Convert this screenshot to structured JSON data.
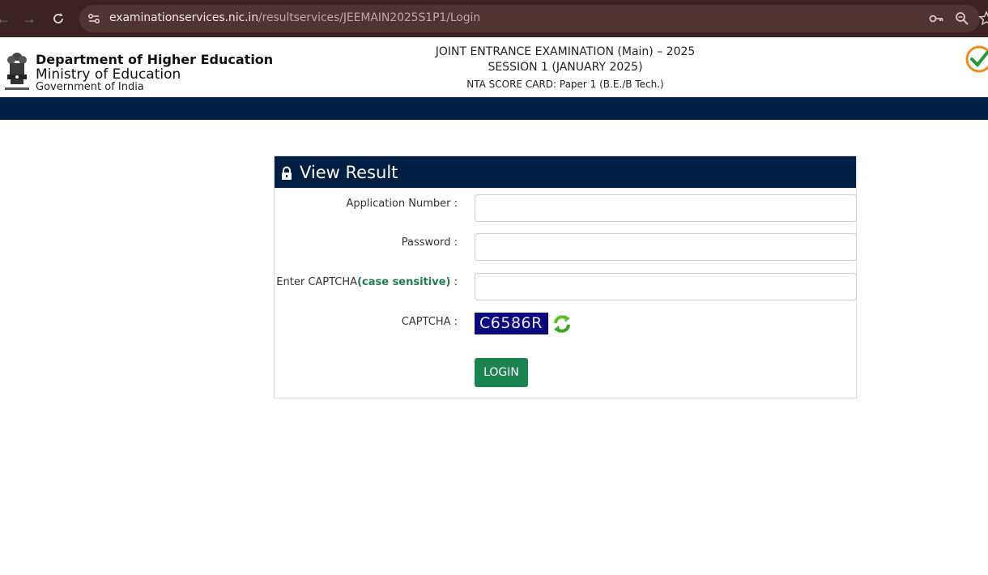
{
  "browser": {
    "url_host": "examinationservices.nic.in",
    "url_path": "/resultservices/JEEMAIN2025S1P1/Login",
    "icons": [
      "back-icon",
      "forward-icon",
      "reload-icon",
      "site-info-icon",
      "key-icon",
      "zoom-icon",
      "star-icon"
    ]
  },
  "header": {
    "dept": "Department of Higher Education",
    "ministry": "Ministry of Education",
    "govt": "Government of India",
    "exam_line1": "JOINT ENTRANCE EXAMINATION (Main) – 2025",
    "exam_line2": "SESSION 1 (JANUARY 2025)",
    "exam_line3": "NTA SCORE CARD: Paper 1 (B.E./B Tech.)"
  },
  "card": {
    "title": "View Result",
    "app_label": "Application Number :",
    "app_value": "",
    "pass_label": "Password :",
    "pass_value": "",
    "captcha_input_label": "Enter CAPTCHA",
    "captcha_note": "(case sensitive)",
    "captcha_input_suffix": " :",
    "captcha_value": "",
    "captcha_label": "CAPTCHA :",
    "captcha_text": "C6586R",
    "login_label": "LOGIN"
  },
  "colors": {
    "browser_bar": "#3c2222",
    "header_strip": "#011f42",
    "accent_green": "#1a8350",
    "captcha_bg": "#0a0a7c"
  }
}
